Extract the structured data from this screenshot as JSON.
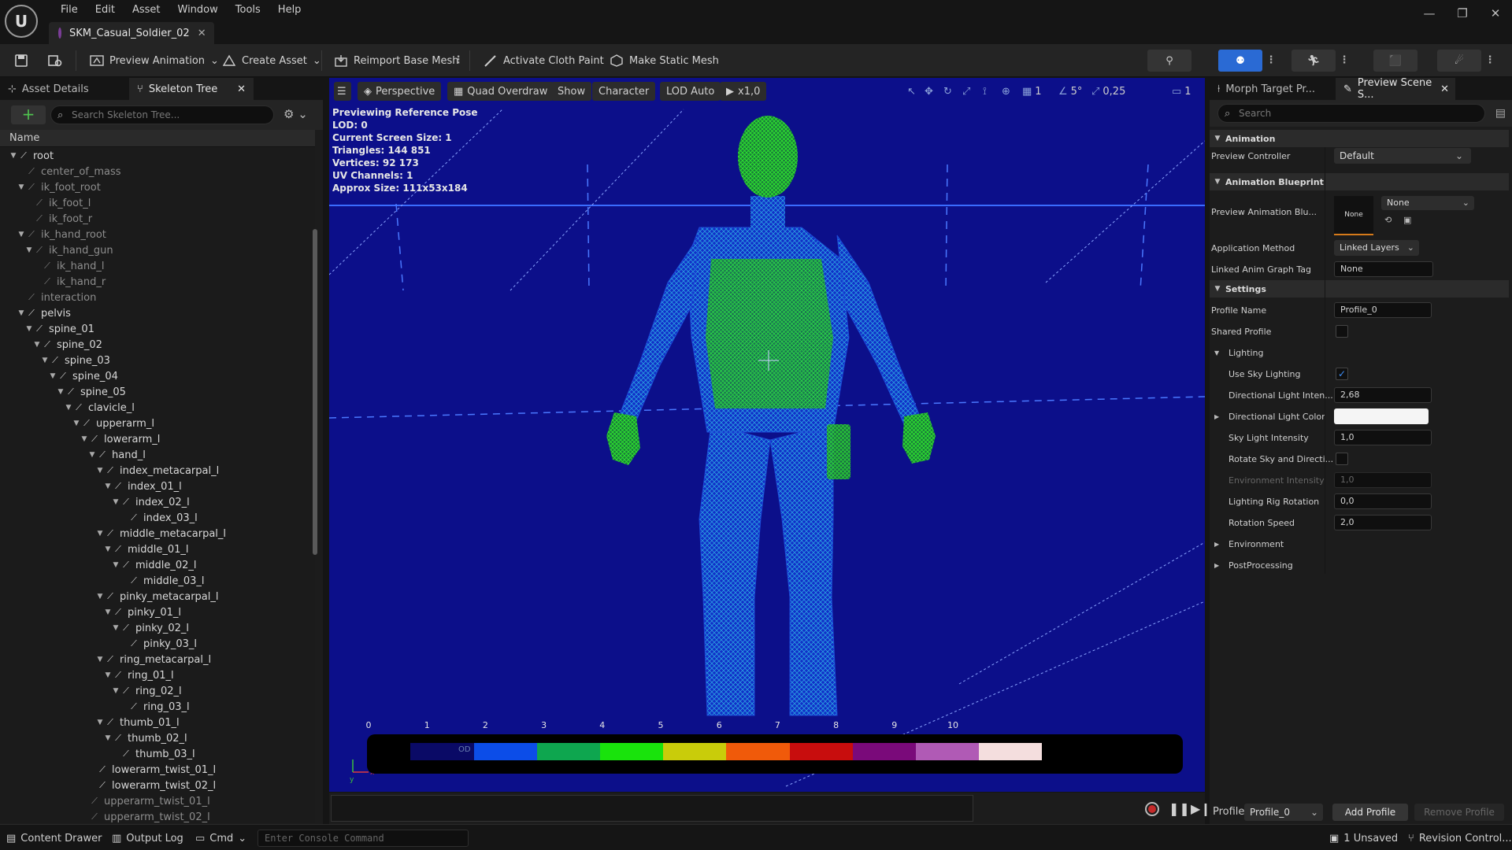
{
  "menubar": {
    "items": [
      "File",
      "Edit",
      "Asset",
      "Window",
      "Tools",
      "Help"
    ],
    "document_tab": "SKM_Casual_Soldier_02"
  },
  "toolbar": {
    "preview_animation": "Preview Animation",
    "create_asset": "Create Asset",
    "reimport": "Reimport Base Mesh",
    "cloth_paint": "Activate Cloth Paint",
    "static_mesh": "Make Static Mesh"
  },
  "left_panel": {
    "tabs": [
      "Asset Details",
      "Skeleton Tree"
    ],
    "search_placeholder": "Search Skeleton Tree...",
    "column_header": "Name",
    "tree": [
      {
        "label": "root",
        "depth": 0,
        "dim": false,
        "expand": true
      },
      {
        "label": "center_of_mass",
        "depth": 1,
        "dim": true,
        "expand": false
      },
      {
        "label": "ik_foot_root",
        "depth": 1,
        "dim": true,
        "expand": true
      },
      {
        "label": "ik_foot_l",
        "depth": 2,
        "dim": true,
        "expand": false
      },
      {
        "label": "ik_foot_r",
        "depth": 2,
        "dim": true,
        "expand": false
      },
      {
        "label": "ik_hand_root",
        "depth": 1,
        "dim": true,
        "expand": true
      },
      {
        "label": "ik_hand_gun",
        "depth": 2,
        "dim": true,
        "expand": true
      },
      {
        "label": "ik_hand_l",
        "depth": 3,
        "dim": true,
        "expand": false
      },
      {
        "label": "ik_hand_r",
        "depth": 3,
        "dim": true,
        "expand": false
      },
      {
        "label": "interaction",
        "depth": 1,
        "dim": true,
        "expand": false
      },
      {
        "label": "pelvis",
        "depth": 1,
        "dim": false,
        "expand": true
      },
      {
        "label": "spine_01",
        "depth": 2,
        "dim": false,
        "expand": true
      },
      {
        "label": "spine_02",
        "depth": 3,
        "dim": false,
        "expand": true
      },
      {
        "label": "spine_03",
        "depth": 4,
        "dim": false,
        "expand": true
      },
      {
        "label": "spine_04",
        "depth": 5,
        "dim": false,
        "expand": true
      },
      {
        "label": "spine_05",
        "depth": 6,
        "dim": false,
        "expand": true
      },
      {
        "label": "clavicle_l",
        "depth": 7,
        "dim": false,
        "expand": true
      },
      {
        "label": "upperarm_l",
        "depth": 8,
        "dim": false,
        "expand": true
      },
      {
        "label": "lowerarm_l",
        "depth": 9,
        "dim": false,
        "expand": true
      },
      {
        "label": "hand_l",
        "depth": 10,
        "dim": false,
        "expand": true
      },
      {
        "label": "index_metacarpal_l",
        "depth": 11,
        "dim": false,
        "expand": true
      },
      {
        "label": "index_01_l",
        "depth": 12,
        "dim": false,
        "expand": true
      },
      {
        "label": "index_02_l",
        "depth": 13,
        "dim": false,
        "expand": true
      },
      {
        "label": "index_03_l",
        "depth": 14,
        "dim": false,
        "expand": false
      },
      {
        "label": "middle_metacarpal_l",
        "depth": 11,
        "dim": false,
        "expand": true
      },
      {
        "label": "middle_01_l",
        "depth": 12,
        "dim": false,
        "expand": true
      },
      {
        "label": "middle_02_l",
        "depth": 13,
        "dim": false,
        "expand": true
      },
      {
        "label": "middle_03_l",
        "depth": 14,
        "dim": false,
        "expand": false
      },
      {
        "label": "pinky_metacarpal_l",
        "depth": 11,
        "dim": false,
        "expand": true
      },
      {
        "label": "pinky_01_l",
        "depth": 12,
        "dim": false,
        "expand": true
      },
      {
        "label": "pinky_02_l",
        "depth": 13,
        "dim": false,
        "expand": true
      },
      {
        "label": "pinky_03_l",
        "depth": 14,
        "dim": false,
        "expand": false
      },
      {
        "label": "ring_metacarpal_l",
        "depth": 11,
        "dim": false,
        "expand": true
      },
      {
        "label": "ring_01_l",
        "depth": 12,
        "dim": false,
        "expand": true
      },
      {
        "label": "ring_02_l",
        "depth": 13,
        "dim": false,
        "expand": true
      },
      {
        "label": "ring_03_l",
        "depth": 14,
        "dim": false,
        "expand": false
      },
      {
        "label": "thumb_01_l",
        "depth": 11,
        "dim": false,
        "expand": true
      },
      {
        "label": "thumb_02_l",
        "depth": 12,
        "dim": false,
        "expand": true
      },
      {
        "label": "thumb_03_l",
        "depth": 13,
        "dim": false,
        "expand": false
      },
      {
        "label": "lowerarm_twist_01_l",
        "depth": 10,
        "dim": false,
        "expand": false
      },
      {
        "label": "lowerarm_twist_02_l",
        "depth": 10,
        "dim": false,
        "expand": false
      },
      {
        "label": "upperarm_twist_01_l",
        "depth": 9,
        "dim": true,
        "expand": false
      },
      {
        "label": "upperarm_twist_02_l",
        "depth": 9,
        "dim": true,
        "expand": false
      }
    ]
  },
  "viewport": {
    "toolbar": {
      "perspective": "Perspective",
      "quad_overdraw": "Quad Overdraw",
      "show": "Show",
      "character": "Character",
      "lod": "LOD Auto",
      "play_rate": "x1,0",
      "grid_num": "1",
      "angle": "5°",
      "scale": "0,25",
      "camera_speed": "1"
    },
    "stats": [
      "Previewing Reference Pose",
      "LOD: 0",
      "Current Screen Size: 1",
      "Triangles: 144 851",
      "Vertices: 92 173",
      "UV Channels: 1",
      "Approx Size: 111x53x184"
    ],
    "legend_od": "OD",
    "scale_labels": [
      "0",
      "1",
      "2",
      "3",
      "4",
      "5",
      "6",
      "7",
      "8",
      "9",
      "10"
    ],
    "overdraw_colors": [
      "#0a0a66",
      "#0c4de8",
      "#0ea64f",
      "#19e30c",
      "#c9cc0a",
      "#f05a0a",
      "#c80d0d",
      "#7a0a7a",
      "#b05ab5",
      "#f4dede"
    ],
    "wire_color": "#2eea2e",
    "bg_color": "#0c0f8a"
  },
  "right_panel": {
    "tabs": [
      "Morph Target Pr...",
      "Preview Scene S..."
    ],
    "search_placeholder": "Search",
    "sections": {
      "animation": "Animation",
      "anim_bp": "Animation Blueprint",
      "settings": "Settings",
      "lighting": "Lighting",
      "environment": "Environment",
      "postprocessing": "PostProcessing"
    },
    "props": {
      "preview_controller_label": "Preview Controller",
      "preview_controller_value": "Default",
      "preview_anim_bp_label": "Preview Animation Blu...",
      "thumb_none": "None",
      "anim_bp_value": "None",
      "application_method_label": "Application Method",
      "application_method_value": "Linked Layers",
      "linked_anim_label": "Linked Anim Graph Tag",
      "linked_anim_value": "None",
      "profile_name_label": "Profile Name",
      "profile_name_value": "Profile_0",
      "shared_profile_label": "Shared Profile",
      "use_sky_label": "Use Sky Lighting",
      "dir_light_int_label": "Directional Light Inten...",
      "dir_light_int_value": "2,68",
      "dir_light_color_label": "Directional Light Color",
      "sky_light_int_label": "Sky Light Intensity",
      "sky_light_int_value": "1,0",
      "rotate_sky_label": "Rotate Sky and Directi...",
      "env_int_label": "Environment Intensity",
      "env_int_value": "1,0",
      "rig_rot_label": "Lighting Rig Rotation",
      "rig_rot_value": "0,0",
      "rot_speed_label": "Rotation Speed",
      "rot_speed_value": "2,0"
    },
    "footer": {
      "profile_label": "Profile",
      "profile_value": "Profile_0",
      "add_profile": "Add Profile",
      "remove_profile": "Remove Profile"
    }
  },
  "statusbar": {
    "content_drawer": "Content Drawer",
    "output_log": "Output Log",
    "cmd": "Cmd",
    "console_placeholder": "Enter Console Command",
    "unsaved": "1 Unsaved",
    "revision": "Revision Control..."
  }
}
